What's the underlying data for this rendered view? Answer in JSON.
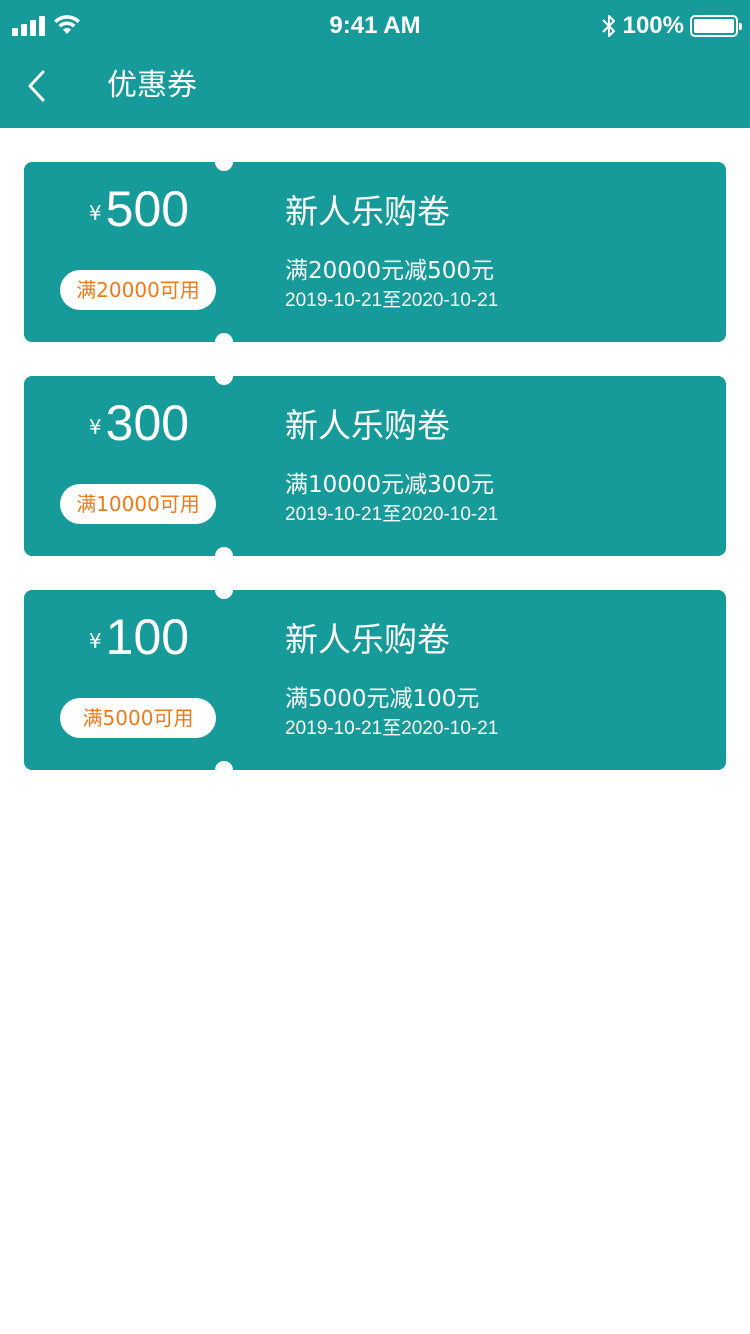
{
  "status_bar": {
    "time": "9:41 AM",
    "battery": "100%",
    "icons": [
      "signal-icon",
      "wifi-icon",
      "bluetooth-icon",
      "battery-icon"
    ]
  },
  "nav": {
    "title": "优惠券",
    "back_icon": "chevron-left-icon"
  },
  "theme": {
    "primary": "#169b9a",
    "badge_text": "#f07a1a",
    "background": "#ffffff"
  },
  "coupons": [
    {
      "currency": "¥",
      "amount": "500",
      "threshold": "满20000可用",
      "title": "新人乐购卷",
      "rule": "满20000元减500元",
      "dates": "2019-10-21至2020-10-21"
    },
    {
      "currency": "¥",
      "amount": "300",
      "threshold": "满10000可用",
      "title": "新人乐购卷",
      "rule": "满10000元减300元",
      "dates": "2019-10-21至2020-10-21"
    },
    {
      "currency": "¥",
      "amount": "100",
      "threshold": "满5000可用",
      "title": "新人乐购卷",
      "rule": "满5000元减100元",
      "dates": "2019-10-21至2020-10-21"
    }
  ]
}
